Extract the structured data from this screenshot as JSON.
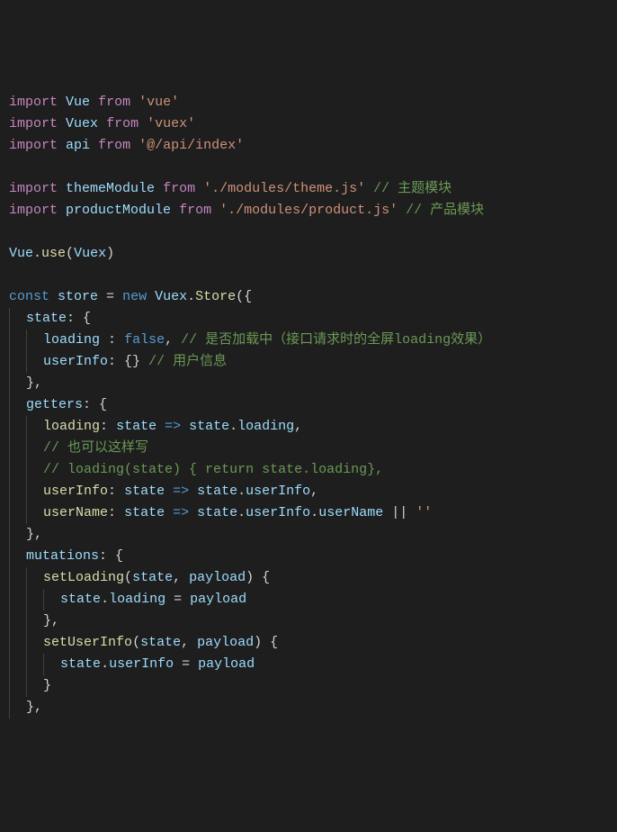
{
  "code": {
    "lines": [
      {
        "tokens": [
          {
            "text": "import",
            "class": "keyword"
          },
          {
            "text": " ",
            "class": "plain"
          },
          {
            "text": "Vue",
            "class": "variable"
          },
          {
            "text": " ",
            "class": "plain"
          },
          {
            "text": "from",
            "class": "keyword"
          },
          {
            "text": " ",
            "class": "plain"
          },
          {
            "text": "'vue'",
            "class": "string"
          }
        ]
      },
      {
        "tokens": [
          {
            "text": "import",
            "class": "keyword"
          },
          {
            "text": " ",
            "class": "plain"
          },
          {
            "text": "Vuex",
            "class": "variable"
          },
          {
            "text": " ",
            "class": "plain"
          },
          {
            "text": "from",
            "class": "keyword"
          },
          {
            "text": " ",
            "class": "plain"
          },
          {
            "text": "'vuex'",
            "class": "string"
          }
        ]
      },
      {
        "tokens": [
          {
            "text": "import",
            "class": "keyword"
          },
          {
            "text": " ",
            "class": "plain"
          },
          {
            "text": "api",
            "class": "variable"
          },
          {
            "text": " ",
            "class": "plain"
          },
          {
            "text": "from",
            "class": "keyword"
          },
          {
            "text": " ",
            "class": "plain"
          },
          {
            "text": "'@/api/index'",
            "class": "string"
          }
        ]
      },
      {
        "tokens": []
      },
      {
        "tokens": [
          {
            "text": "import",
            "class": "keyword"
          },
          {
            "text": " ",
            "class": "plain"
          },
          {
            "text": "themeModule",
            "class": "variable"
          },
          {
            "text": " ",
            "class": "plain"
          },
          {
            "text": "from",
            "class": "keyword"
          },
          {
            "text": " ",
            "class": "plain"
          },
          {
            "text": "'./modules/theme.js'",
            "class": "string"
          },
          {
            "text": " ",
            "class": "plain"
          },
          {
            "text": "// 主题模块",
            "class": "comment"
          }
        ]
      },
      {
        "tokens": [
          {
            "text": "import",
            "class": "keyword"
          },
          {
            "text": " ",
            "class": "plain"
          },
          {
            "text": "productModule",
            "class": "variable"
          },
          {
            "text": " ",
            "class": "plain"
          },
          {
            "text": "from",
            "class": "keyword"
          },
          {
            "text": " ",
            "class": "plain"
          },
          {
            "text": "'./modules/product.js'",
            "class": "string"
          },
          {
            "text": " ",
            "class": "plain"
          },
          {
            "text": "// 产品模块",
            "class": "comment"
          }
        ]
      },
      {
        "tokens": []
      },
      {
        "tokens": [
          {
            "text": "Vue",
            "class": "variable"
          },
          {
            "text": ".",
            "class": "punct"
          },
          {
            "text": "use",
            "class": "identifier"
          },
          {
            "text": "(",
            "class": "punct"
          },
          {
            "text": "Vuex",
            "class": "variable"
          },
          {
            "text": ")",
            "class": "punct"
          }
        ]
      },
      {
        "tokens": []
      },
      {
        "tokens": [
          {
            "text": "const",
            "class": "const-blue"
          },
          {
            "text": " ",
            "class": "plain"
          },
          {
            "text": "store",
            "class": "variable"
          },
          {
            "text": " = ",
            "class": "plain"
          },
          {
            "text": "new",
            "class": "const-blue"
          },
          {
            "text": " ",
            "class": "plain"
          },
          {
            "text": "Vuex",
            "class": "variable"
          },
          {
            "text": ".",
            "class": "punct"
          },
          {
            "text": "Store",
            "class": "identifier"
          },
          {
            "text": "({",
            "class": "punct"
          }
        ]
      },
      {
        "indent": 1,
        "tokens": [
          {
            "text": "state",
            "class": "variable"
          },
          {
            "text": ": {",
            "class": "punct"
          }
        ]
      },
      {
        "indent": 2,
        "tokens": [
          {
            "text": "loading",
            "class": "variable"
          },
          {
            "text": " : ",
            "class": "plain"
          },
          {
            "text": "false",
            "class": "const-blue"
          },
          {
            "text": ", ",
            "class": "punct"
          },
          {
            "text": "// 是否加载中（接口请求时的全屏loading效果）",
            "class": "comment"
          }
        ]
      },
      {
        "indent": 2,
        "tokens": [
          {
            "text": "userInfo",
            "class": "variable"
          },
          {
            "text": ": {} ",
            "class": "punct"
          },
          {
            "text": "// 用户信息",
            "class": "comment"
          }
        ]
      },
      {
        "indent": 1,
        "tokens": [
          {
            "text": "},",
            "class": "punct"
          }
        ]
      },
      {
        "indent": 1,
        "tokens": [
          {
            "text": "getters",
            "class": "variable"
          },
          {
            "text": ": {",
            "class": "punct"
          }
        ]
      },
      {
        "indent": 2,
        "tokens": [
          {
            "text": "loading",
            "class": "identifier"
          },
          {
            "text": ": ",
            "class": "punct"
          },
          {
            "text": "state",
            "class": "variable"
          },
          {
            "text": " ",
            "class": "plain"
          },
          {
            "text": "=>",
            "class": "const-blue"
          },
          {
            "text": " ",
            "class": "plain"
          },
          {
            "text": "state",
            "class": "variable"
          },
          {
            "text": ".",
            "class": "punct"
          },
          {
            "text": "loading",
            "class": "variable"
          },
          {
            "text": ",",
            "class": "punct"
          }
        ]
      },
      {
        "indent": 2,
        "tokens": [
          {
            "text": "// 也可以这样写",
            "class": "comment"
          }
        ]
      },
      {
        "indent": 2,
        "tokens": [
          {
            "text": "// loading(state) { return state.loading},",
            "class": "comment"
          }
        ]
      },
      {
        "indent": 2,
        "tokens": [
          {
            "text": "userInfo",
            "class": "identifier"
          },
          {
            "text": ": ",
            "class": "punct"
          },
          {
            "text": "state",
            "class": "variable"
          },
          {
            "text": " ",
            "class": "plain"
          },
          {
            "text": "=>",
            "class": "const-blue"
          },
          {
            "text": " ",
            "class": "plain"
          },
          {
            "text": "state",
            "class": "variable"
          },
          {
            "text": ".",
            "class": "punct"
          },
          {
            "text": "userInfo",
            "class": "variable"
          },
          {
            "text": ",",
            "class": "punct"
          }
        ]
      },
      {
        "indent": 2,
        "tokens": [
          {
            "text": "userName",
            "class": "identifier"
          },
          {
            "text": ": ",
            "class": "punct"
          },
          {
            "text": "state",
            "class": "variable"
          },
          {
            "text": " ",
            "class": "plain"
          },
          {
            "text": "=>",
            "class": "const-blue"
          },
          {
            "text": " ",
            "class": "plain"
          },
          {
            "text": "state",
            "class": "variable"
          },
          {
            "text": ".",
            "class": "punct"
          },
          {
            "text": "userInfo",
            "class": "variable"
          },
          {
            "text": ".",
            "class": "punct"
          },
          {
            "text": "userName",
            "class": "variable"
          },
          {
            "text": " || ",
            "class": "plain"
          },
          {
            "text": "''",
            "class": "string"
          }
        ]
      },
      {
        "indent": 1,
        "tokens": [
          {
            "text": "},",
            "class": "punct"
          }
        ]
      },
      {
        "indent": 1,
        "tokens": [
          {
            "text": "mutations",
            "class": "variable"
          },
          {
            "text": ": {",
            "class": "punct"
          }
        ]
      },
      {
        "indent": 2,
        "tokens": [
          {
            "text": "setLoading",
            "class": "identifier"
          },
          {
            "text": "(",
            "class": "punct"
          },
          {
            "text": "state",
            "class": "variable"
          },
          {
            "text": ", ",
            "class": "punct"
          },
          {
            "text": "payload",
            "class": "variable"
          },
          {
            "text": ") {",
            "class": "punct"
          }
        ]
      },
      {
        "indent": 3,
        "tokens": [
          {
            "text": "state",
            "class": "variable"
          },
          {
            "text": ".",
            "class": "punct"
          },
          {
            "text": "loading",
            "class": "variable"
          },
          {
            "text": " = ",
            "class": "plain"
          },
          {
            "text": "payload",
            "class": "variable"
          }
        ]
      },
      {
        "indent": 2,
        "tokens": [
          {
            "text": "},",
            "class": "punct"
          }
        ]
      },
      {
        "indent": 2,
        "tokens": [
          {
            "text": "setUserInfo",
            "class": "identifier"
          },
          {
            "text": "(",
            "class": "punct"
          },
          {
            "text": "state",
            "class": "variable"
          },
          {
            "text": ", ",
            "class": "punct"
          },
          {
            "text": "payload",
            "class": "variable"
          },
          {
            "text": ") {",
            "class": "punct"
          }
        ]
      },
      {
        "indent": 3,
        "tokens": [
          {
            "text": "state",
            "class": "variable"
          },
          {
            "text": ".",
            "class": "punct"
          },
          {
            "text": "userInfo",
            "class": "variable"
          },
          {
            "text": " = ",
            "class": "plain"
          },
          {
            "text": "payload",
            "class": "variable"
          }
        ]
      },
      {
        "indent": 2,
        "tokens": [
          {
            "text": "}",
            "class": "punct"
          }
        ]
      },
      {
        "indent": 1,
        "tokens": [
          {
            "text": "},",
            "class": "punct"
          }
        ]
      }
    ]
  }
}
